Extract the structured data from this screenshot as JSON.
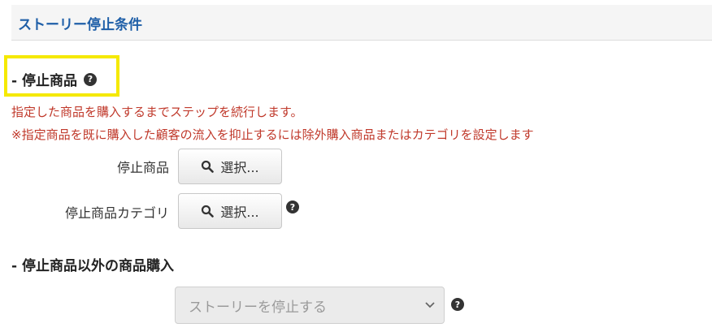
{
  "section": {
    "title": "ストーリー停止条件"
  },
  "stop_products": {
    "heading": "- 停止商品",
    "help_icon": "question-circle-icon",
    "notice_1": "指定した商品を購入するまでステップを続行します。",
    "notice_2": "※指定商品を既に購入した顧客の流入を抑止するには除外購入商品またはカテゴリを設定します",
    "product_label": "停止商品",
    "category_label": "停止商品カテゴリ",
    "select_button_label": "選択..."
  },
  "other_purchase": {
    "heading": "- 停止商品以外の商品購入",
    "select_value": "ストーリーを停止する"
  },
  "colors": {
    "title": "#1f5fa8",
    "notice": "#c0392b",
    "highlight": "#f5e900"
  }
}
